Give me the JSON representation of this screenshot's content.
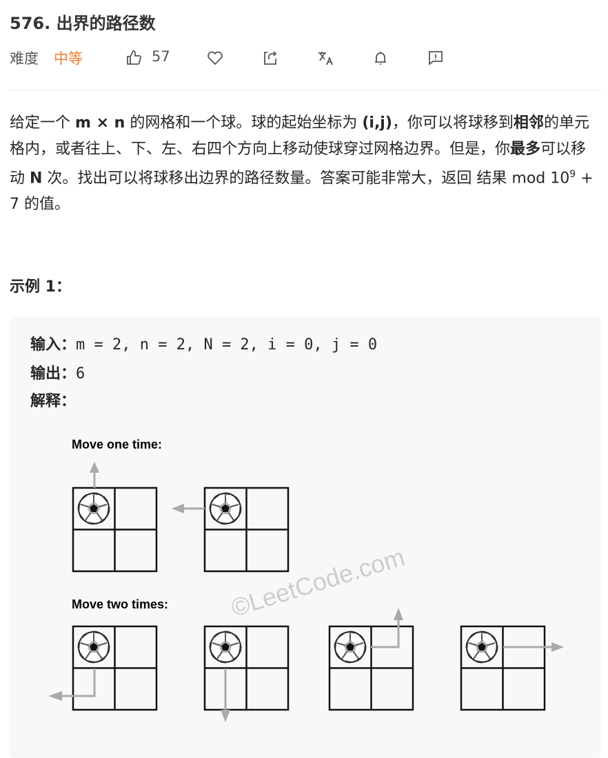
{
  "title": "576. 出界的路径数",
  "meta": {
    "difficulty_label": "难度",
    "difficulty": "中等",
    "likes": "57"
  },
  "colors": {
    "difficulty": "#ef7d31"
  },
  "description": [
    {
      "t": "给定一个 "
    },
    {
      "t": "m × n",
      "b": true
    },
    {
      "t": " 的网格和一个球。球的起始坐标为 "
    },
    {
      "t": "(i,j)",
      "b": true
    },
    {
      "t": "，你可以将球移到"
    },
    {
      "t": "相邻",
      "b": true
    },
    {
      "t": "的单元格内，或者往上、下、左、右四个方向上移动使球穿过网格边界。但是，你"
    },
    {
      "t": "最多",
      "b": true
    },
    {
      "t": "可以移动 "
    },
    {
      "t": "N",
      "b": true
    },
    {
      "t": " 次。找出可以将球移出边界的路径数量。答案可能非常大，返回 结果 mod 10"
    },
    {
      "t": "9",
      "sup": true
    },
    {
      "t": " + 7 的值。"
    }
  ],
  "example": {
    "heading": "示例 1：",
    "input_label": "输入：",
    "input": "m = 2, n = 2, N = 2, i = 0, j = 0",
    "output_label": "输出：",
    "output": "6",
    "explain_label": "解释：",
    "fig_one": "Move one time:",
    "fig_two": "Move two times:",
    "watermark": "©LeetCode.com"
  }
}
